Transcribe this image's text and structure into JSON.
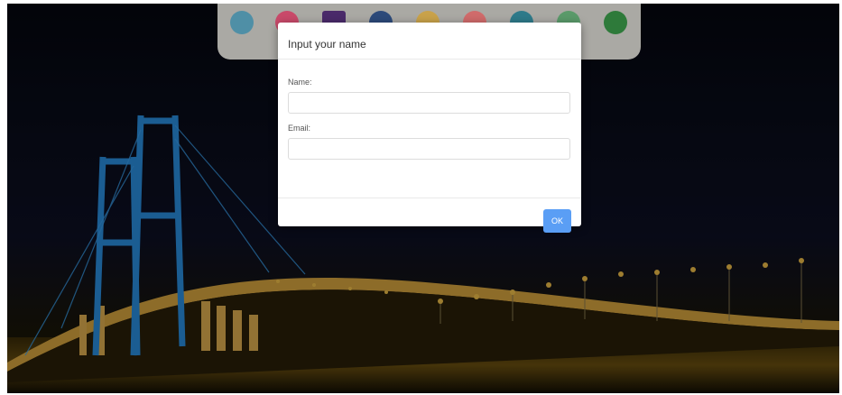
{
  "modal": {
    "title": "Input your name",
    "name_label": "Name:",
    "name_value": "",
    "email_label": "Email:",
    "email_value": "",
    "ok_label": "OK"
  },
  "colors": {
    "primary_button": "#5a9ef5",
    "logo_bar": "#aaa9a4",
    "night_sky": "#0a0d1c",
    "bridge_tower_light": "#2a8fe0",
    "bridge_lights": "#f2b53a"
  },
  "background": {
    "subject": "suspension-bridge-at-night"
  },
  "logos": [
    {
      "name": "globe-logo",
      "color": "#4f8fa6"
    },
    {
      "name": "star-emblem-logo",
      "color": "#c94a6a"
    },
    {
      "name": "purple-badge-logo",
      "color": "#4a2a6a"
    },
    {
      "name": "blue-shield-logo",
      "color": "#2c4a7a"
    },
    {
      "name": "gold-crest-logo",
      "color": "#c9a24a"
    },
    {
      "name": "red-mark-logo",
      "color": "#d06b6b"
    },
    {
      "name": "teal-seal-logo",
      "color": "#2e7a8a"
    },
    {
      "name": "green-outline-logo",
      "color": "#5a9a6a"
    },
    {
      "name": "green-crest-logo",
      "color": "#2e7a3a"
    }
  ]
}
